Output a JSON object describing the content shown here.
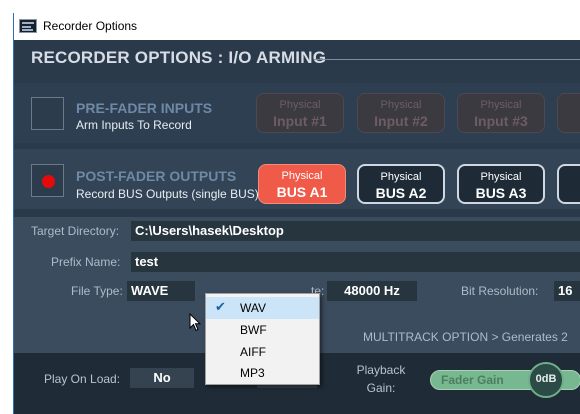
{
  "window": {
    "title": "Recorder Options"
  },
  "page_title": "RECORDER OPTIONS : I/O ARMING",
  "pre_fader": {
    "title": "PRE-FADER INPUTS",
    "subtitle": "Arm Inputs To Record",
    "buttons": [
      {
        "line1": "Physical",
        "line2": "Input #1"
      },
      {
        "line1": "Physical",
        "line2": "Input #2"
      },
      {
        "line1": "Physical",
        "line2": "Input #3"
      }
    ]
  },
  "post_fader": {
    "title": "POST-FADER OUTPUTS",
    "subtitle": "Record BUS Outputs (single BUS)",
    "buttons": [
      {
        "line1": "Physical",
        "line2": "BUS A1",
        "active": true
      },
      {
        "line1": "Physical",
        "line2": "BUS A2",
        "active": false
      },
      {
        "line1": "Physical",
        "line2": "BUS A3",
        "active": false
      }
    ]
  },
  "form": {
    "target_directory_label": "Target Directory:",
    "target_directory_value": "C:\\Users\\hasek\\Desktop",
    "prefix_name_label": "Prefix Name:",
    "prefix_name_value": "test",
    "file_type_label": "File Type:",
    "file_type_value": "WAVE",
    "samplerate_label_partial": "te:",
    "samplerate_value": "48000 Hz",
    "bit_resolution_label": "Bit Resolution:",
    "bit_resolution_value_partial": "16",
    "multitrack_note": "MULTITRACK OPTION > Generates 2"
  },
  "file_type_menu": {
    "selected": "WAV",
    "options": [
      "WAV",
      "BWF",
      "AIFF",
      "MP3"
    ]
  },
  "bottom": {
    "play_on_load_label": "Play On Load:",
    "play_on_load_value": "No",
    "playback_gain_label_line1": "Playback",
    "playback_gain_label_line2": "Gain:",
    "fader_label": "Fader Gain",
    "fader_value": "0dB"
  },
  "colors": {
    "accent_active": "#f05a48",
    "arm_dot": "#e50b0b",
    "fader": "#78b890"
  }
}
